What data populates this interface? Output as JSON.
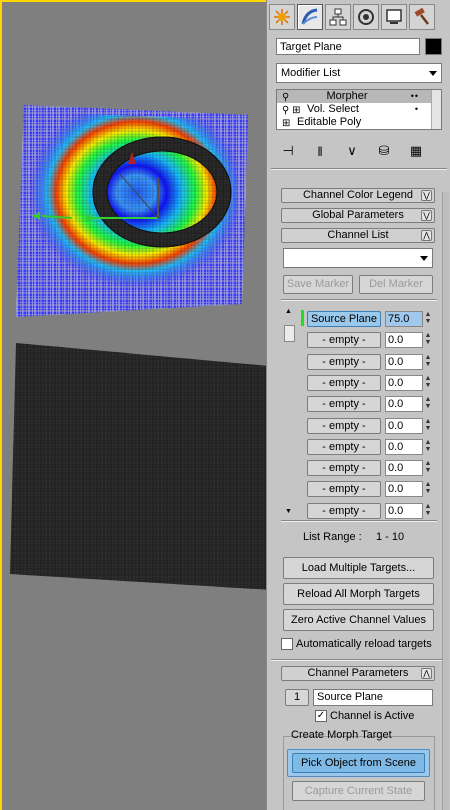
{
  "panel_tabs": [
    {
      "name": "create-tab",
      "icon": "sun-star-icon"
    },
    {
      "name": "modify-tab",
      "icon": "modify-bend-icon",
      "active": true
    },
    {
      "name": "hierarchy-tab",
      "icon": "hierarchy-icon"
    },
    {
      "name": "motion-tab",
      "icon": "motion-circle-icon"
    },
    {
      "name": "display-tab",
      "icon": "display-monitor-icon"
    },
    {
      "name": "utilities-tab",
      "icon": "hammer-icon"
    }
  ],
  "object_name": "Target Plane",
  "object_color": "#000000",
  "modifier_list": "Modifier List",
  "modifier_stack": [
    {
      "label": "Morpher",
      "icon": "bulb-icon",
      "selected": true
    },
    {
      "label": "Vol. Select",
      "icon": "bulb-plus-icon"
    },
    {
      "label": "Editable Poly",
      "icon": "plus-icon"
    }
  ],
  "rollouts": {
    "channel_color_legend": "Channel Color Legend",
    "global_parameters": "Global Parameters",
    "channel_list": "Channel List",
    "channel_parameters": "Channel Parameters"
  },
  "markers": {
    "save": "Save Marker",
    "del": "Del Marker"
  },
  "channels": [
    {
      "label": "Source Plane",
      "value": "75.0",
      "active": true
    },
    {
      "label": "- empty -",
      "value": "0.0"
    },
    {
      "label": "- empty -",
      "value": "0.0"
    },
    {
      "label": "- empty -",
      "value": "0.0"
    },
    {
      "label": "- empty -",
      "value": "0.0"
    },
    {
      "label": "- empty -",
      "value": "0.0"
    },
    {
      "label": "- empty -",
      "value": "0.0"
    },
    {
      "label": "- empty -",
      "value": "0.0"
    },
    {
      "label": "- empty -",
      "value": "0.0"
    },
    {
      "label": "- empty -",
      "value": "0.0"
    }
  ],
  "list_range": {
    "label": "List Range :",
    "value": "1 - 10"
  },
  "buttons": {
    "load_multiple": "Load Multiple Targets...",
    "reload_all": "Reload All Morph Targets",
    "zero_active": "Zero Active Channel Values",
    "pick_object": "Pick Object from Scene",
    "capture_state": "Capture Current State"
  },
  "auto_reload": {
    "label": "Automatically reload targets",
    "checked": false
  },
  "channel_params": {
    "number": "1",
    "name": "Source Plane",
    "active_label": "Channel is Active",
    "active_checked": true,
    "create_group": "Create Morph Target"
  }
}
